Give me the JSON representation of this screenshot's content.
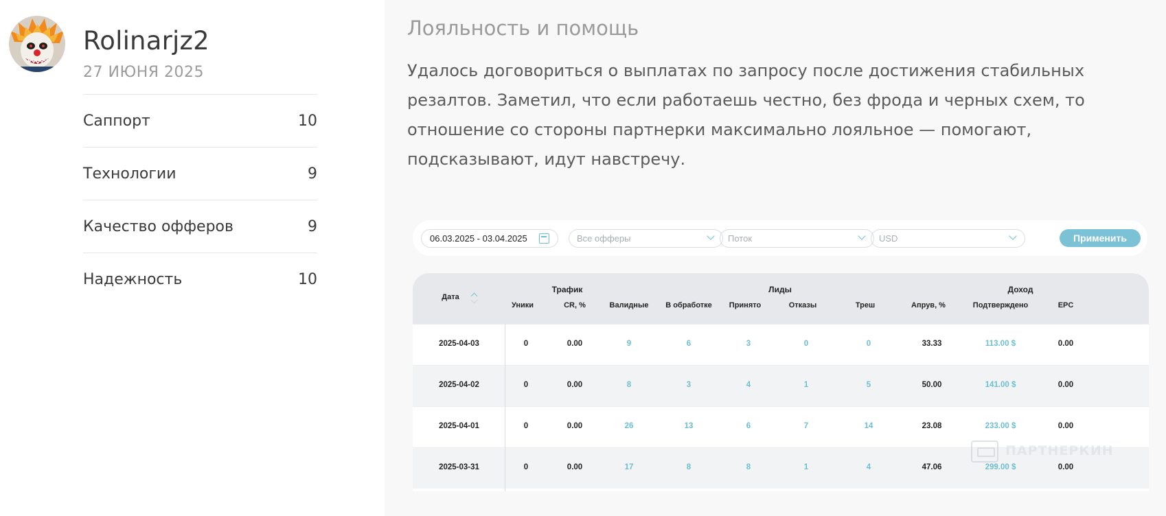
{
  "user": {
    "name": "Rolinarjz2",
    "date": "27 ИЮНЯ 2025"
  },
  "ratings": [
    {
      "label": "Саппорт",
      "score": "10"
    },
    {
      "label": "Технологии",
      "score": "9"
    },
    {
      "label": "Качество офферов",
      "score": "9"
    },
    {
      "label": "Надежность",
      "score": "10"
    }
  ],
  "review": {
    "title": "Лояльность и помощь",
    "text": "Удалось договориться о выплатах по запросу после достижения стабильных резалтов. Заметил, что если работаешь честно, без фрода и черных схем, то отношение со стороны партнерки максимально лояльное — помогают, подсказывают, идут навстречу."
  },
  "filters": {
    "date_range": "06.03.2025 - 03.04.2025",
    "offers_placeholder": "Все офферы",
    "stream_placeholder": "Поток",
    "currency_placeholder": "USD",
    "apply_label": "Применить"
  },
  "table": {
    "groups": {
      "traffic": "Трафик",
      "leads": "Лиды",
      "income": "Доход"
    },
    "headers": {
      "date": "Дата",
      "uniques": "Уники",
      "cr": "CR, %",
      "valid": "Валидные",
      "processing": "В обработке",
      "accepted": "Принято",
      "rejected": "Отказы",
      "trash": "Треш",
      "approve": "Апрув, %",
      "confirmed": "Подтверждено",
      "epc": "EPC"
    },
    "rows": [
      {
        "date": "2025-04-03",
        "uniques": "0",
        "cr": "0.00",
        "valid": "9",
        "processing": "6",
        "accepted": "3",
        "rejected": "0",
        "trash": "0",
        "approve": "33.33",
        "confirmed": "113.00 $",
        "epc": "0.00"
      },
      {
        "date": "2025-04-02",
        "uniques": "0",
        "cr": "0.00",
        "valid": "8",
        "processing": "3",
        "accepted": "4",
        "rejected": "1",
        "trash": "5",
        "approve": "50.00",
        "confirmed": "141.00 $",
        "epc": "0.00"
      },
      {
        "date": "2025-04-01",
        "uniques": "0",
        "cr": "0.00",
        "valid": "26",
        "processing": "13",
        "accepted": "6",
        "rejected": "7",
        "trash": "14",
        "approve": "23.08",
        "confirmed": "233.00 $",
        "epc": "0.00"
      },
      {
        "date": "2025-03-31",
        "uniques": "0",
        "cr": "0.00",
        "valid": "17",
        "processing": "8",
        "accepted": "8",
        "rejected": "1",
        "trash": "4",
        "approve": "47.06",
        "confirmed": "299.00 $",
        "epc": "0.00"
      }
    ]
  },
  "watermark": "ПАРТНЕРКИН",
  "colors": {
    "accent": "#7cc2d6",
    "link": "#6cbfd2",
    "header_bg": "#e6e8ec"
  }
}
